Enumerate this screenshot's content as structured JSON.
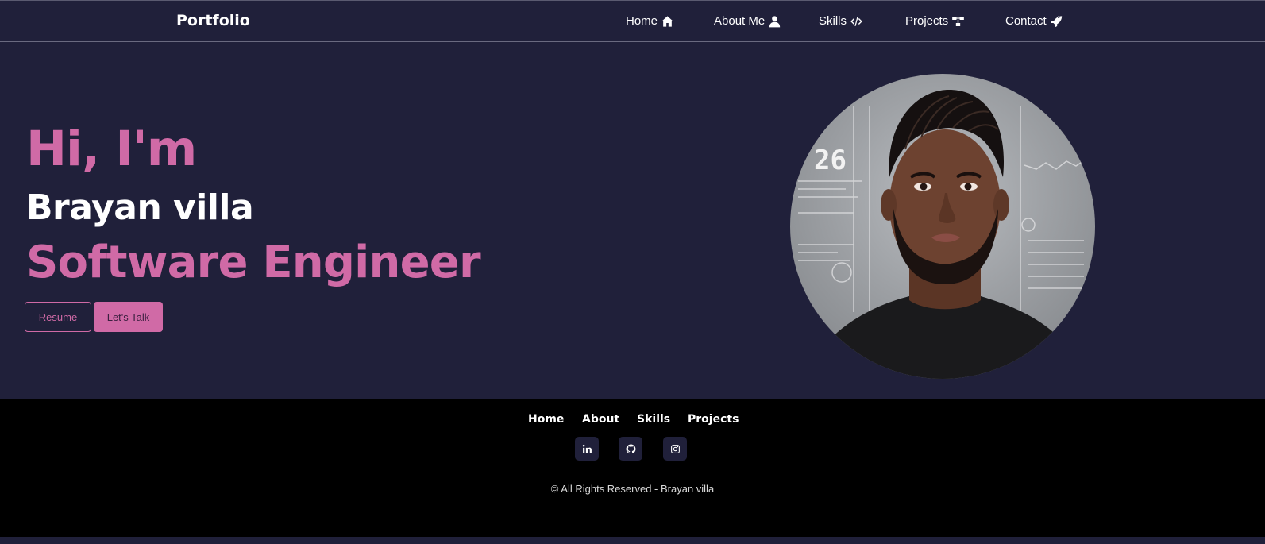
{
  "navbar": {
    "brand": "Portfolio",
    "links": [
      {
        "label": "Home",
        "icon": "home-icon"
      },
      {
        "label": "About Me",
        "icon": "user-icon"
      },
      {
        "label": "Skills",
        "icon": "code-icon"
      },
      {
        "label": "Projects",
        "icon": "project-diagram-icon"
      },
      {
        "label": "Contact",
        "icon": "rocket-icon"
      }
    ]
  },
  "hero": {
    "greeting": "Hi, I'm",
    "name": "Brayan villa",
    "role": "Software Engineer",
    "resume_label": "Resume",
    "talk_label": "Let's Talk",
    "avatar_overlay_number": "26"
  },
  "footer": {
    "links": [
      "Home",
      "About",
      "Skills",
      "Projects"
    ],
    "social": [
      {
        "icon": "linkedin-icon"
      },
      {
        "icon": "github-icon"
      },
      {
        "icon": "instagram-icon"
      }
    ],
    "copyright": "© All Rights Reserved - Brayan villa"
  },
  "colors": {
    "background": "#20203a",
    "accent": "#d06aa6",
    "footer_bg": "#000000"
  }
}
